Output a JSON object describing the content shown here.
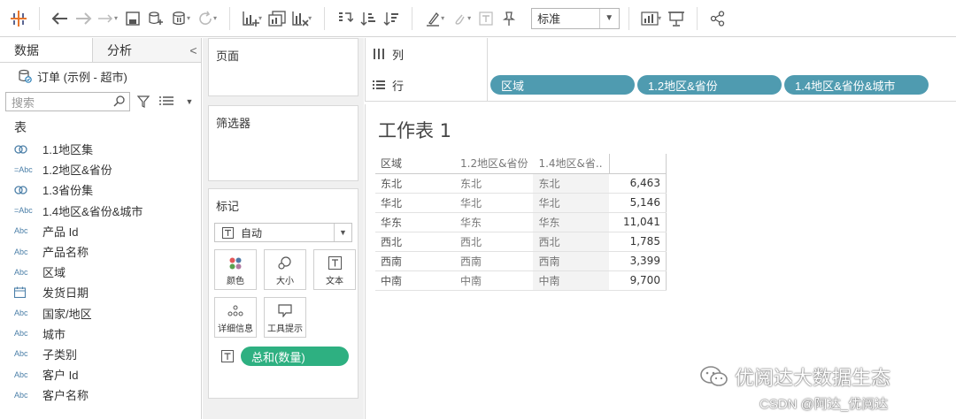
{
  "toolbar": {
    "style_select": "标准"
  },
  "left_pane": {
    "tabs": [
      "数据",
      "分析"
    ],
    "collapse_glyph": "<",
    "datasource": "订单 (示例 - 超市)",
    "search_placeholder": "搜索",
    "section_title": "表",
    "fields": [
      {
        "type": "set",
        "type_label": "",
        "label": "1.1地区集"
      },
      {
        "type": "hier",
        "type_label": "=Abc",
        "label": "1.2地区&省份"
      },
      {
        "type": "set",
        "type_label": "",
        "label": "1.3省份集"
      },
      {
        "type": "hier",
        "type_label": "=Abc",
        "label": "1.4地区&省份&城市"
      },
      {
        "type": "abc",
        "type_label": "Abc",
        "label": "产品 Id"
      },
      {
        "type": "abc",
        "type_label": "Abc",
        "label": "产品名称"
      },
      {
        "type": "abc",
        "type_label": "Abc",
        "label": "区域"
      },
      {
        "type": "date",
        "type_label": "",
        "label": "发货日期"
      },
      {
        "type": "abc",
        "type_label": "Abc",
        "label": "国家/地区"
      },
      {
        "type": "abc",
        "type_label": "Abc",
        "label": "城市"
      },
      {
        "type": "abc",
        "type_label": "Abc",
        "label": "子类别"
      },
      {
        "type": "abc",
        "type_label": "Abc",
        "label": "客户 Id"
      },
      {
        "type": "abc",
        "type_label": "Abc",
        "label": "客户名称"
      }
    ]
  },
  "shelves": {
    "pages_title": "页面",
    "filters_title": "筛选器",
    "marks_title": "标记",
    "mark_type": "自动",
    "mark_buttons": [
      "颜色",
      "大小",
      "文本",
      "详细信息",
      "工具提示"
    ],
    "measure_pill": "总和(数量)",
    "columns_label": "列",
    "rows_label": "行",
    "row_pills": [
      "区域",
      "1.2地区&省份",
      "1.4地区&省份&城市"
    ]
  },
  "view": {
    "sheet_title": "工作表 1",
    "headers": [
      "区域",
      "1.2地区&省份",
      "1.4地区&省.."
    ],
    "rows": [
      {
        "region": "东北",
        "province": "东北",
        "city": "东北",
        "value": "6,463"
      },
      {
        "region": "华北",
        "province": "华北",
        "city": "华北",
        "value": "5,146"
      },
      {
        "region": "华东",
        "province": "华东",
        "city": "华东",
        "value": "11,041"
      },
      {
        "region": "西北",
        "province": "西北",
        "city": "西北",
        "value": "1,785"
      },
      {
        "region": "西南",
        "province": "西南",
        "city": "西南",
        "value": "3,399"
      },
      {
        "region": "中南",
        "province": "中南",
        "city": "中南",
        "value": "9,700"
      }
    ]
  },
  "overlay": {
    "watermark": "优阅达大数据生态",
    "credit": "CSDN @阿达_优阅达"
  },
  "colors": {
    "row_pill": "#4f9bb0",
    "measure_pill": "#2eb081"
  }
}
